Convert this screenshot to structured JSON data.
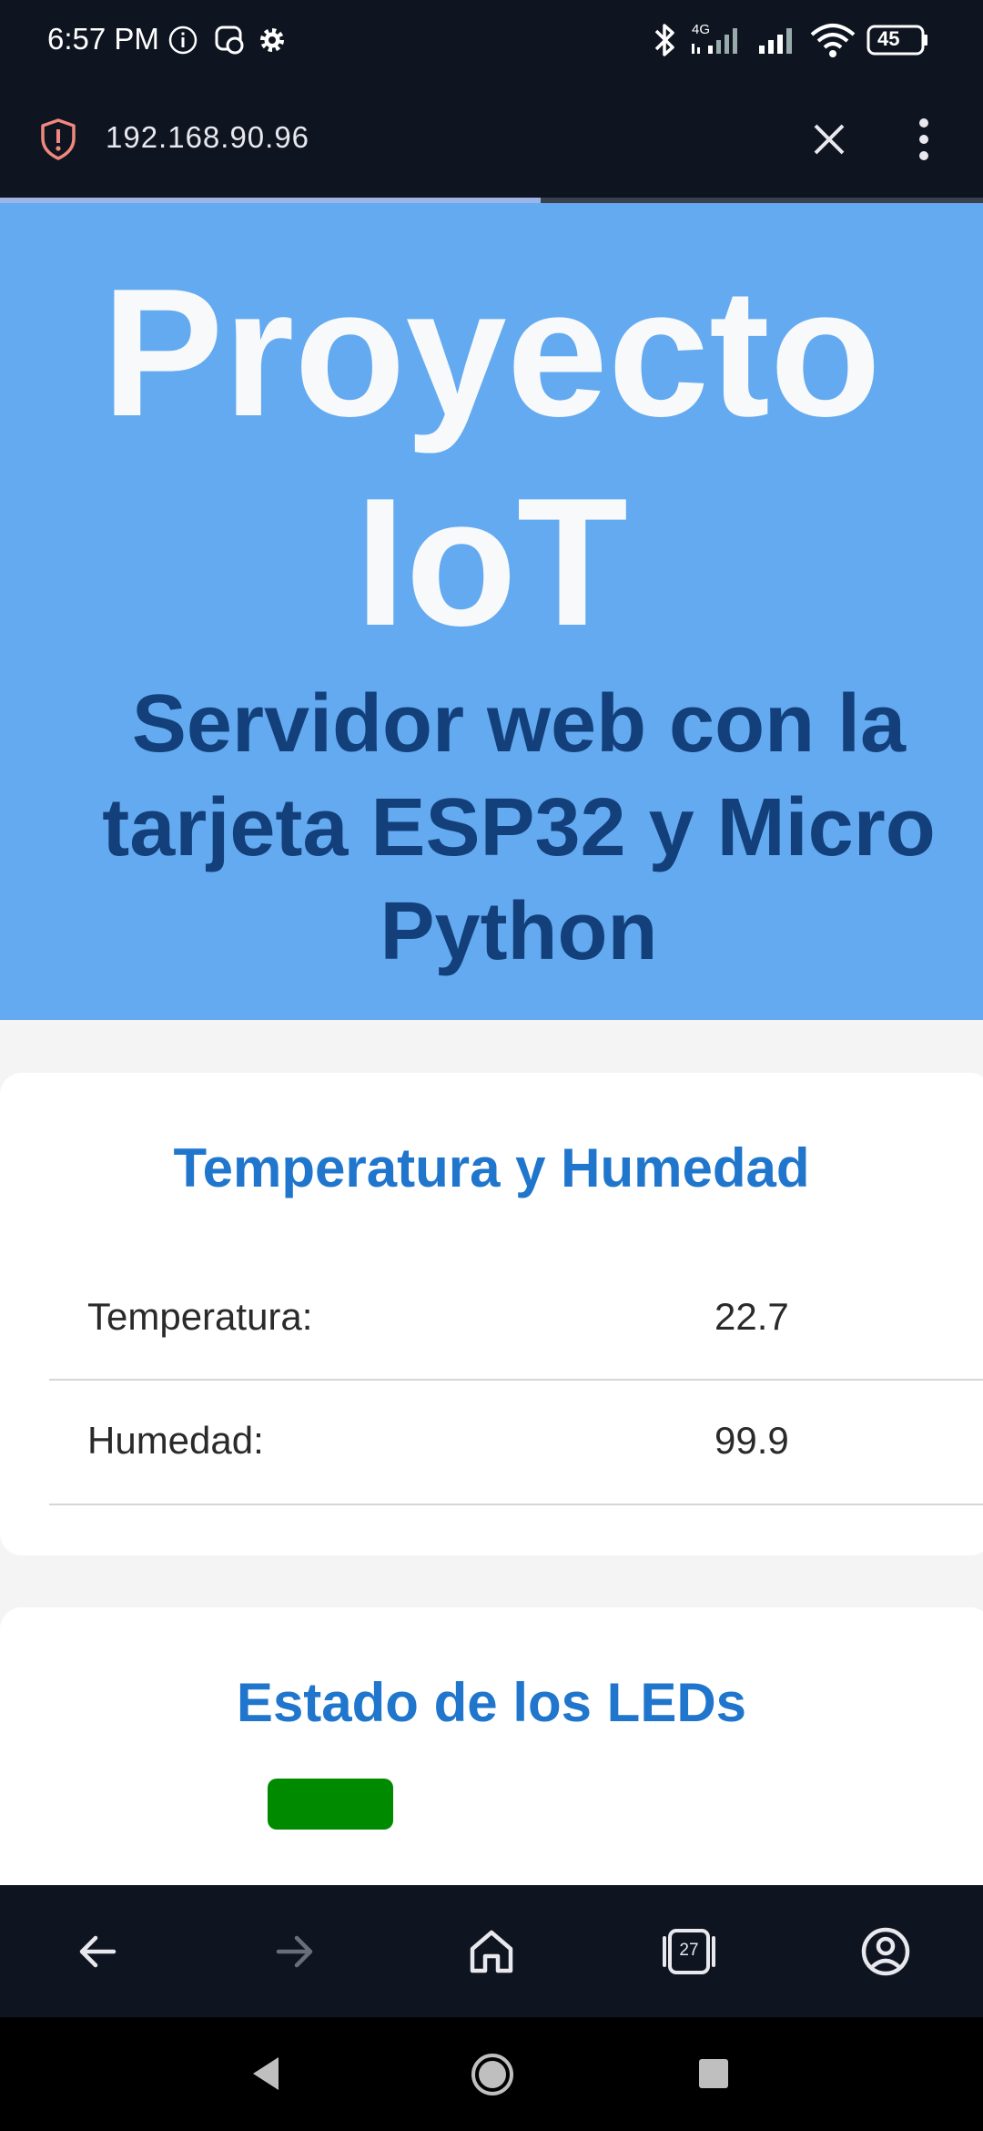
{
  "status_bar": {
    "time": "6:57 PM",
    "network_label": "4G",
    "battery_level": "45",
    "icons": [
      "info-icon",
      "chat-bubble-icon",
      "settings-gear-icon",
      "bluetooth-icon",
      "signal-icon",
      "signal-icon",
      "wifi-icon",
      "battery-icon"
    ]
  },
  "browser": {
    "url": "192.168.90.96",
    "security_icon": "warning-shield-icon",
    "load_progress": 0.55,
    "tab_count": "27"
  },
  "header": {
    "title": "Proyecto IoT",
    "subtitle": "Servidor web con la tarjeta ESP32 y Micro Python",
    "background": "#64aaf0"
  },
  "sensor_card": {
    "title": "Temperatura y Humedad",
    "rows": [
      {
        "label": "Temperatura:",
        "value": "22.7"
      },
      {
        "label": "Humedad:",
        "value": "99.9"
      }
    ]
  },
  "led_card": {
    "title": "Estado de los LEDs",
    "led_color": "#008a00"
  },
  "nav": {
    "items": [
      "back-arrow-icon",
      "forward-arrow-icon",
      "home-icon",
      "tabs-icon",
      "account-icon"
    ]
  }
}
